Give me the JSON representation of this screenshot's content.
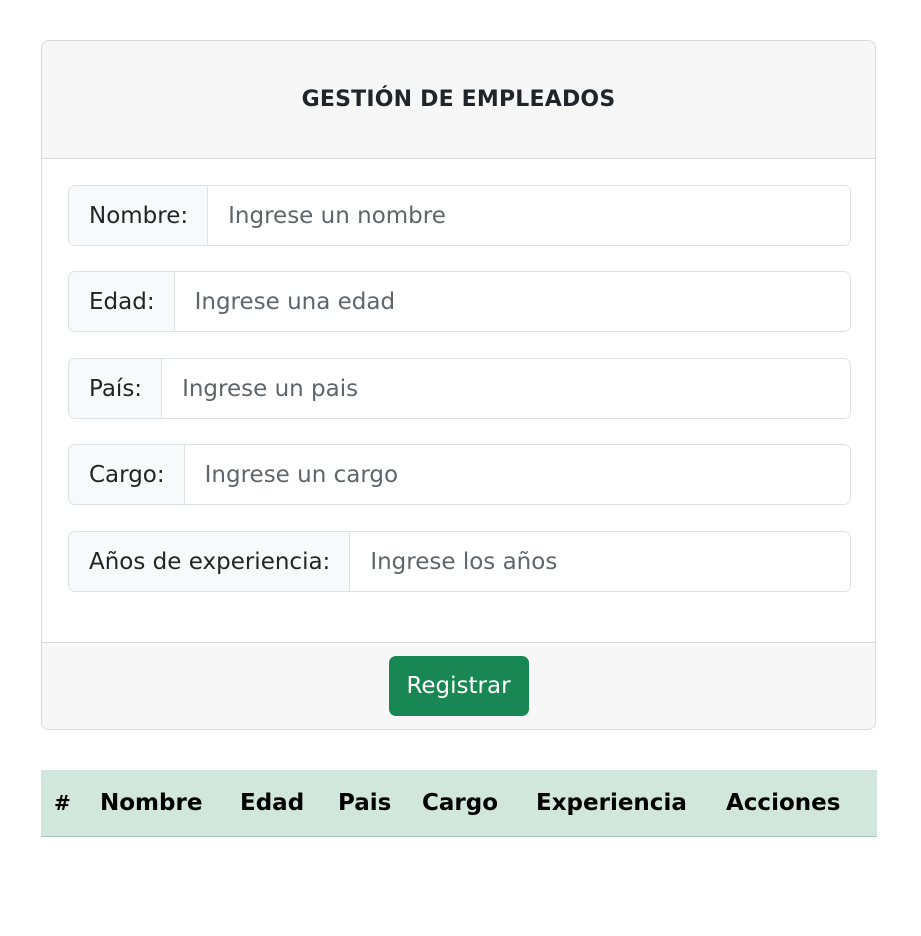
{
  "form": {
    "title": "GESTIÓN DE EMPLEADOS",
    "fields": [
      {
        "label": "Nombre:",
        "placeholder": "Ingrese un nombre",
        "value": ""
      },
      {
        "label": "Edad:",
        "placeholder": "Ingrese una edad",
        "value": ""
      },
      {
        "label": "País:",
        "placeholder": "Ingrese un pais",
        "value": ""
      },
      {
        "label": "Cargo:",
        "placeholder": "Ingrese un cargo",
        "value": ""
      },
      {
        "label": "Años de experiencia:",
        "placeholder": "Ingrese los años",
        "value": ""
      }
    ],
    "submit_label": "Registrar"
  },
  "table": {
    "columns": [
      "#",
      "Nombre",
      "Edad",
      "Pais",
      "Cargo",
      "Experiencia",
      "Acciones"
    ],
    "rows": []
  },
  "colors": {
    "primary_button": "#198754",
    "table_header_bg": "#d1e7dd"
  }
}
